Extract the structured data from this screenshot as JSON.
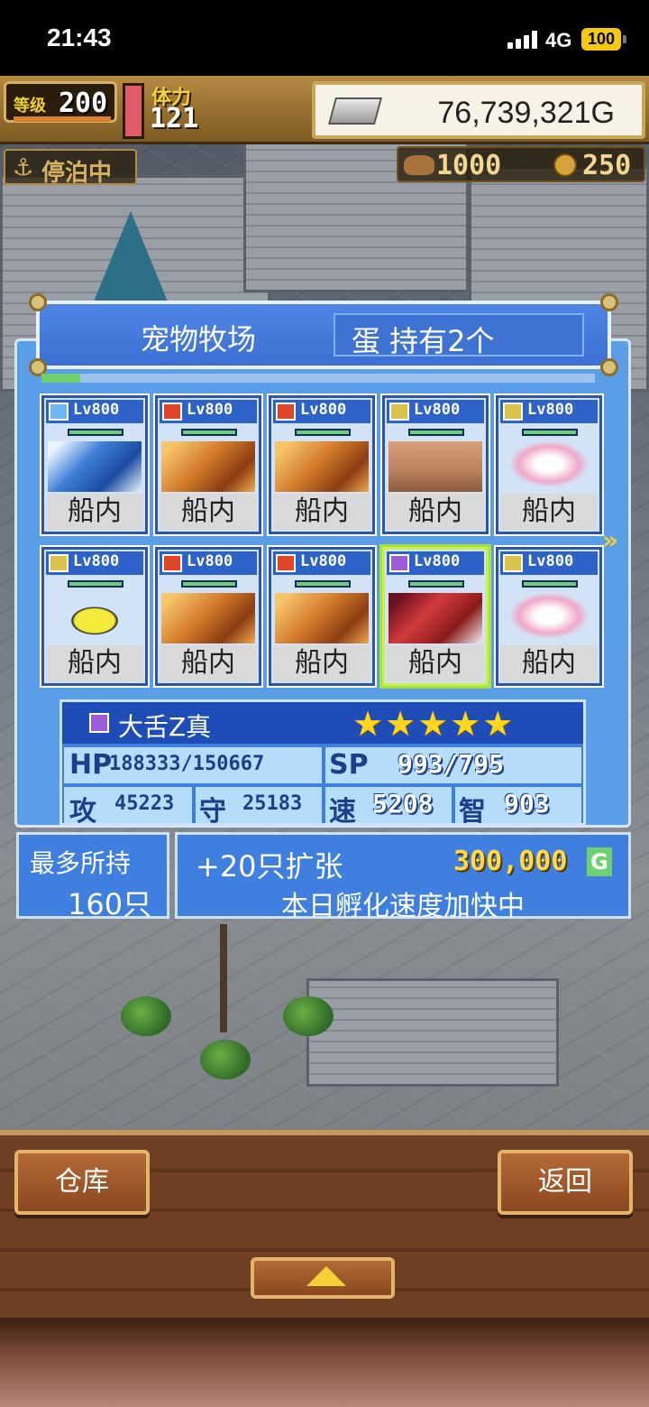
{
  "status_bar": {
    "time": "21:43",
    "network": "4G",
    "battery": "100"
  },
  "hud": {
    "level_icon": "等级",
    "level": "200",
    "stamina_label": "体力",
    "stamina": "121",
    "gold": "76,739,321G",
    "anchor_label": "停泊中",
    "resource1": "1000",
    "resource2": "250"
  },
  "panel": {
    "title": "宠物牧场",
    "egg_text": "蛋 持有2个",
    "progress": 0.07
  },
  "pets": [
    {
      "element": "ice",
      "level": "Lv800",
      "location": "船内",
      "sprite": "blue-dragon",
      "selected": false
    },
    {
      "element": "fire",
      "level": "Lv800",
      "location": "船内",
      "sprite": "orange-dragon",
      "selected": false
    },
    {
      "element": "fire",
      "level": "Lv800",
      "location": "船内",
      "sprite": "orange-dragon",
      "selected": false
    },
    {
      "element": "thunder",
      "level": "Lv800",
      "location": "船内",
      "sprite": "stone-golem",
      "selected": false
    },
    {
      "element": "thunder",
      "level": "Lv800",
      "location": "船内",
      "sprite": "pink-axolotl",
      "selected": false
    },
    {
      "element": "thunder",
      "level": "Lv800",
      "location": "船内",
      "sprite": "yellow-blob",
      "selected": false
    },
    {
      "element": "fire",
      "level": "Lv800",
      "location": "船内",
      "sprite": "orange-dragon",
      "selected": false
    },
    {
      "element": "fire",
      "level": "Lv800",
      "location": "船内",
      "sprite": "orange-dragon",
      "selected": false
    },
    {
      "element": "dark",
      "level": "Lv800",
      "location": "船内",
      "sprite": "red-tongue-monster",
      "selected": true
    },
    {
      "element": "thunder",
      "level": "Lv800",
      "location": "船内",
      "sprite": "pink-axolotl",
      "selected": false
    }
  ],
  "selected_pet": {
    "name": "大舌Z真",
    "stars": "★★★★★",
    "hp_label": "HP",
    "hp": "188333/150667",
    "sp_label": "SP",
    "sp": "993/795",
    "atk_label": "攻",
    "atk": "45223",
    "def_label": "守",
    "def": "25183",
    "spd_label": "速",
    "spd": "5208",
    "int_label": "智",
    "int": "903"
  },
  "capacity": {
    "label": "最多所持",
    "value": "160只"
  },
  "expand": {
    "label": "+20只扩张",
    "cost": "300,000",
    "cost_unit": "G",
    "status": "本日孵化速度加快中"
  },
  "buttons": {
    "warehouse": "仓库",
    "back": "返回"
  },
  "colors": {
    "panel": "#5b9ee8",
    "header": "#3d6fd3",
    "selected": "#a9e233",
    "gold": "#f3cf38",
    "wood": "#8a4720"
  }
}
